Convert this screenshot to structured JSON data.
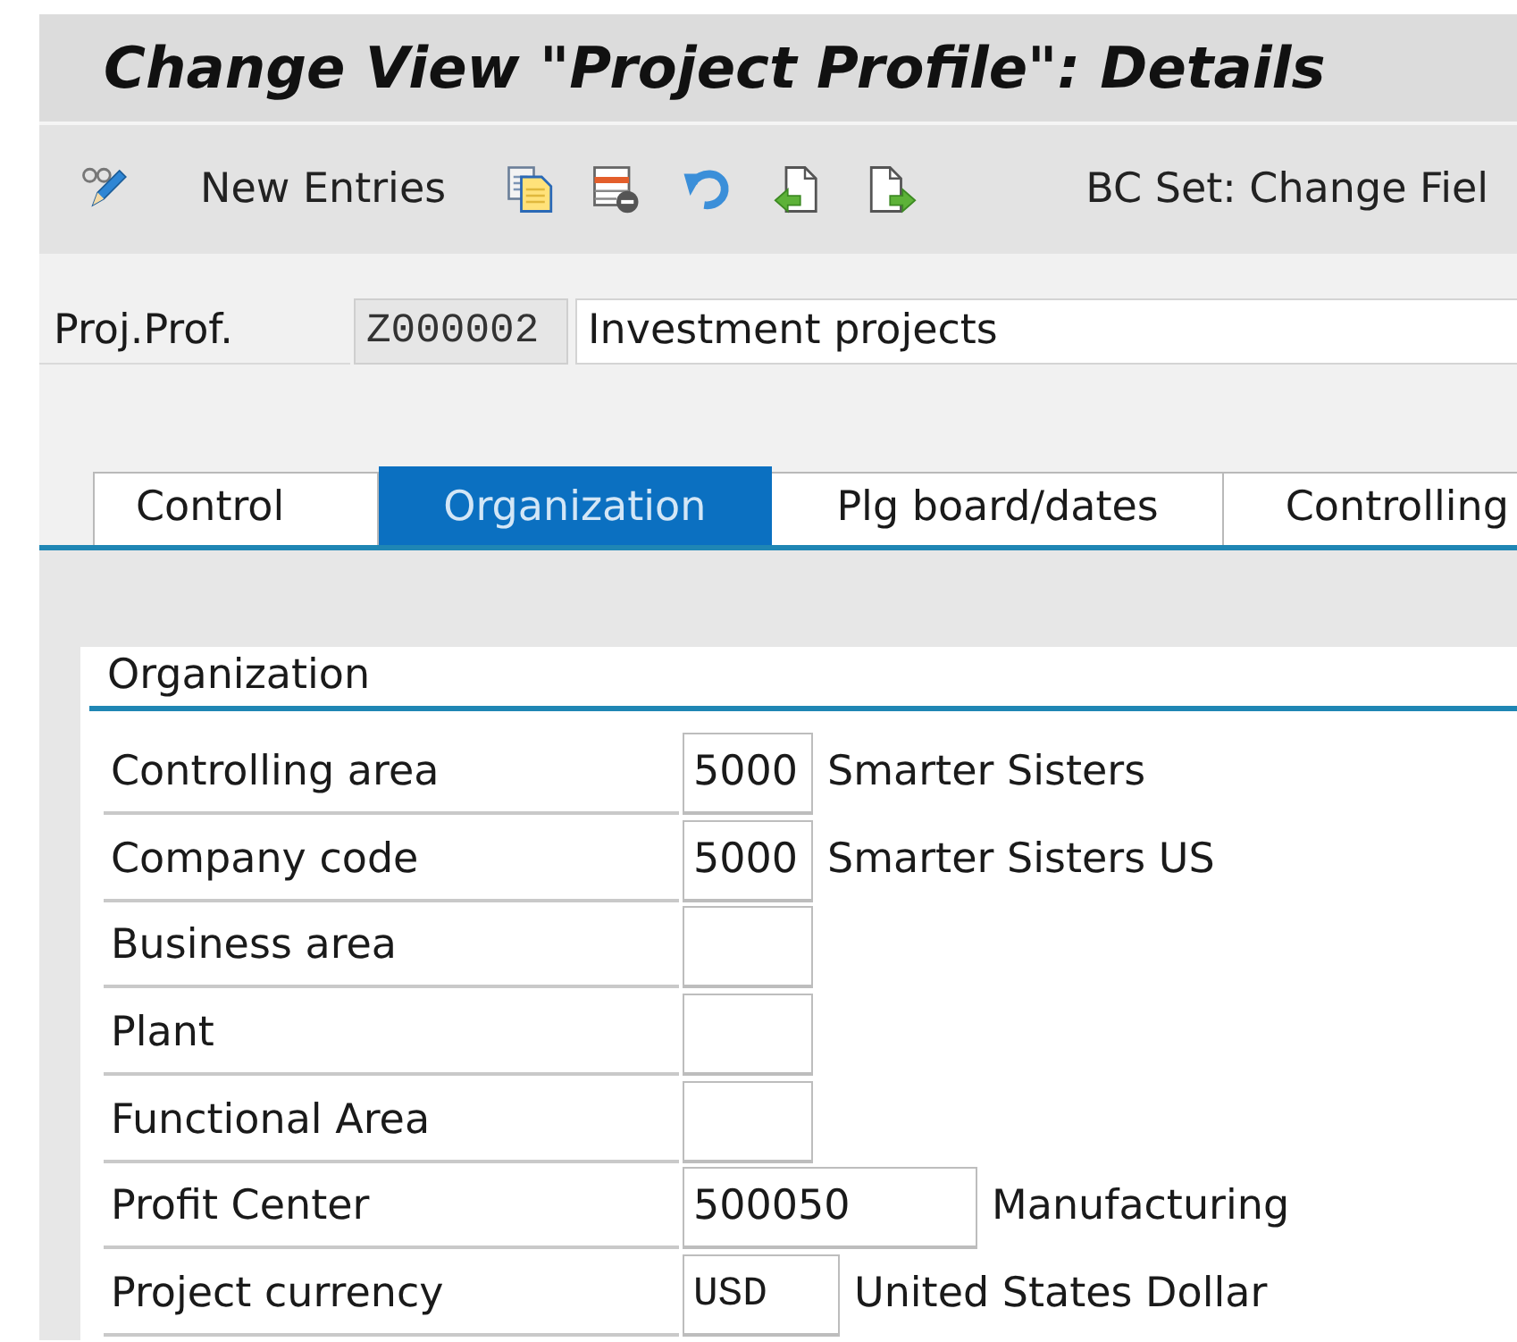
{
  "window": {
    "title": "Change View \"Project Profile\": Details"
  },
  "toolbar": {
    "new_entries": "New Entries",
    "bc_set": "BC Set: Change Fiel"
  },
  "header": {
    "label": "Proj.Prof.",
    "code": {
      "value": "Z000002",
      "disabled": true
    },
    "description": "Investment projects"
  },
  "tabs": [
    {
      "label": "Control",
      "selected": false
    },
    {
      "label": "Organization",
      "selected": true
    },
    {
      "label": "Plg board/dates",
      "selected": false
    },
    {
      "label": "Controlling",
      "selected": false
    }
  ],
  "section": {
    "title": "Organization",
    "fields": [
      {
        "label": "Controlling area",
        "value": "5000",
        "description": "Smarter Sisters"
      },
      {
        "label": "Company code",
        "value": "5000",
        "description": "Smarter Sisters US"
      },
      {
        "label": "Business area"
      },
      {
        "label": "Plant"
      },
      {
        "label": "Functional Area"
      },
      {
        "label": "Profit Center",
        "value": "500050",
        "description": "Manufacturing"
      },
      {
        "label": "Project currency",
        "value": "USD",
        "description": "United States Dollar"
      }
    ]
  }
}
